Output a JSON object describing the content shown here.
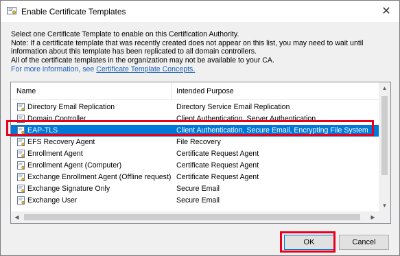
{
  "window": {
    "title": "Enable Certificate Templates",
    "close_label": "✕"
  },
  "description": {
    "lines": [
      "Select one Certificate Template to enable on this Certification Authority.",
      "Note: If a certificate template that was recently created does not appear on this list, you may need to wait until",
      "information about this template has been replicated to all domain controllers.",
      "All of the certificate templates in the organization may not be available to your CA."
    ],
    "more_info_prefix": "For more information, see ",
    "more_info_link": "Certificate Template Concepts."
  },
  "list": {
    "columns": {
      "name": "Name",
      "purpose": "Intended Purpose"
    },
    "rows": [
      {
        "name": "Directory Email Replication",
        "purpose": "Directory Service Email Replication"
      },
      {
        "name": "Domain Controller",
        "purpose": "Client Authentication, Server Authentication"
      },
      {
        "name": "EAP-TLS",
        "purpose": "Client Authentication, Secure Email, Encrypting File System",
        "selected": true
      },
      {
        "name": "EFS Recovery Agent",
        "purpose": "File Recovery"
      },
      {
        "name": "Enrollment Agent",
        "purpose": "Certificate Request Agent"
      },
      {
        "name": "Enrollment Agent (Computer)",
        "purpose": "Certificate Request Agent"
      },
      {
        "name": "Exchange Enrollment Agent (Offline request)",
        "purpose": "Certificate Request Agent"
      },
      {
        "name": "Exchange Signature Only",
        "purpose": "Secure Email"
      },
      {
        "name": "Exchange User",
        "purpose": "Secure Email"
      }
    ]
  },
  "buttons": {
    "ok": "OK",
    "cancel": "Cancel"
  },
  "colors": {
    "selection": "#0078d7",
    "highlight": "#e8001c",
    "link": "#1a5fb4"
  },
  "icons": {
    "title": "certificate-icon",
    "row": "certificate-template-icon"
  }
}
